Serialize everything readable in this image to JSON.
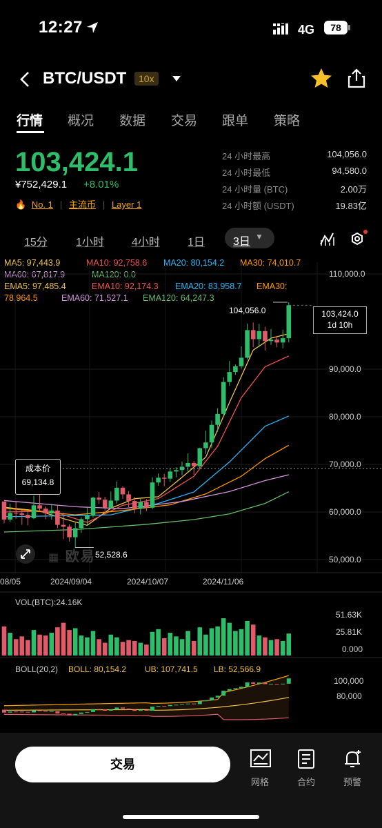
{
  "status": {
    "time": "12:27",
    "network": "4G",
    "battery": "78"
  },
  "header": {
    "pair": "BTC/USDT",
    "leverage": "10x"
  },
  "tabs": [
    "行情",
    "概况",
    "数据",
    "交易",
    "跟单",
    "策略"
  ],
  "price": {
    "last": "103,424.1",
    "cny": "¥752,429.1",
    "change": "+8.01%"
  },
  "tags": [
    "No. 1",
    "主流币",
    "Layer 1"
  ],
  "stats": [
    {
      "label": "24 小时最高",
      "value": "104,056.0"
    },
    {
      "label": "24 小时最低",
      "value": "94,580.0"
    },
    {
      "label": "24 小时量 (BTC)",
      "value": "2.00万"
    },
    {
      "label": "24 小时额 (USDT)",
      "value": "19.83亿"
    }
  ],
  "intervals": [
    "15分",
    "1小时",
    "4小时",
    "1日"
  ],
  "interval_active": "3日",
  "ma_legend": {
    "ma5": "MA5: 97,443.9",
    "ma10": "MA10: 92,758.6",
    "ma20": "MA20: 80,154.2",
    "ma30": "MA30: 74,010.7",
    "ma60": "MA60: 67,817.9",
    "ma120": "MA120: 0.0",
    "ema5": "EMA5: 97,485.4",
    "ema10": "EMA10: 92,174.3",
    "ema20": "EMA20: 83,958.7",
    "ema30a": "EMA30:",
    "ema30b": "78,964.5",
    "ema60": "EMA60: 71,527.1",
    "ema120": "EMA120: 64,247.3"
  },
  "chart": {
    "high_label": "104,056.0",
    "low_label": "52,528.6",
    "current_price": "103,424.0",
    "countdown": "1d 10h",
    "cost_label": "成本价",
    "cost_value": "69,134.8",
    "watermark": "欧易",
    "dates": [
      "08/05",
      "2024/09/04",
      "2024/10/07",
      "2024/11/06"
    ],
    "vol_label": "VOL(BTC):24.16K",
    "vol_ticks": [
      "51.63K",
      "25.81K",
      "0.000"
    ],
    "boll_title": "BOLL(20,2)",
    "boll_mid": "BOLL: 80,154.2",
    "boll_ub": "UB: 107,741.5",
    "boll_lb": "LB: 52,566.9",
    "boll_ticks": [
      "100,000",
      "80,000"
    ]
  },
  "chart_data": {
    "type": "candlestick",
    "title": "BTC/USDT 3日",
    "y_ticks": [
      110000,
      90000,
      80000,
      70000,
      60000,
      50000
    ],
    "ylim": [
      49500,
      112000
    ],
    "candles": [
      [
        62200,
        62200,
        58400,
        57600
      ],
      [
        58400,
        61700,
        59800,
        57900
      ],
      [
        59800,
        62300,
        59700,
        58600
      ],
      [
        59700,
        60400,
        59400,
        57300
      ],
      [
        59400,
        60200,
        58700,
        57200
      ],
      [
        58700,
        63400,
        61400,
        58500
      ],
      [
        61400,
        65000,
        60700,
        60200
      ],
      [
        60700,
        61200,
        59700,
        58500
      ],
      [
        59700,
        61700,
        60300,
        58400
      ],
      [
        60300,
        61400,
        57300,
        56600
      ],
      [
        57300,
        59800,
        56900,
        54300
      ],
      [
        56900,
        57400,
        54700,
        53800
      ],
      [
        54700,
        57800,
        56600,
        52500
      ],
      [
        56600,
        58900,
        58500,
        55600
      ],
      [
        58500,
        61000,
        59200,
        57200
      ],
      [
        59200,
        63200,
        63000,
        58800
      ],
      [
        63000,
        64200,
        62600,
        61700
      ],
      [
        62600,
        63200,
        60900,
        60300
      ],
      [
        60900,
        64300,
        62400,
        60600
      ],
      [
        62400,
        66400,
        65100,
        61800
      ],
      [
        65100,
        65400,
        63700,
        62800
      ],
      [
        63700,
        64400,
        62300,
        61000
      ],
      [
        62300,
        63200,
        60700,
        59700
      ],
      [
        60700,
        62800,
        62100,
        59500
      ],
      [
        62100,
        62700,
        60900,
        60200
      ],
      [
        60900,
        67300,
        66200,
        60600
      ],
      [
        66200,
        68100,
        67200,
        65500
      ],
      [
        67200,
        68000,
        67000,
        65400
      ],
      [
        67000,
        69300,
        68500,
        66300
      ],
      [
        68500,
        69400,
        68800,
        67300
      ],
      [
        68800,
        70600,
        69500,
        67700
      ],
      [
        69500,
        72300,
        70300,
        68500
      ],
      [
        70300,
        70700,
        69600,
        67800
      ],
      [
        69600,
        73500,
        73400,
        69000
      ],
      [
        73400,
        77100,
        74600,
        72200
      ],
      [
        74600,
        79200,
        78300,
        73400
      ],
      [
        78300,
        81800,
        80600,
        76800
      ],
      [
        80600,
        88300,
        87300,
        80100
      ],
      [
        87300,
        91700,
        89400,
        86500
      ],
      [
        89400,
        91000,
        90600,
        88800
      ],
      [
        90600,
        94800,
        92400,
        90100
      ],
      [
        92400,
        99600,
        98200,
        92000
      ],
      [
        98200,
        99800,
        96300,
        94600
      ],
      [
        96300,
        99500,
        98000,
        94600
      ],
      [
        98000,
        98900,
        95900,
        93900
      ],
      [
        95900,
        98400,
        96200,
        95100
      ],
      [
        96200,
        97000,
        95600,
        94600
      ],
      [
        95600,
        98300,
        96500,
        94400
      ],
      [
        96500,
        104056,
        103424,
        95600
      ]
    ],
    "volume": [
      32000,
      25000,
      18000,
      21000,
      17000,
      28000,
      23000,
      22000,
      25000,
      31000,
      36000,
      28000,
      30000,
      22000,
      20000,
      27000,
      18000,
      14000,
      23000,
      20000,
      15000,
      17000,
      16000,
      14000,
      12000,
      26000,
      29000,
      19000,
      25000,
      21000,
      18000,
      27000,
      16000,
      31000,
      23000,
      30000,
      32000,
      41000,
      36000,
      27000,
      29000,
      38000,
      34000,
      22000,
      20000,
      17000,
      18000,
      16000,
      24160
    ],
    "lines": [
      {
        "name": "MA5",
        "color": "#f0c24a",
        "values": [
          [
            0,
            61000
          ],
          [
            6,
            60200
          ],
          [
            10,
            58600
          ],
          [
            14,
            57200
          ],
          [
            18,
            60800
          ],
          [
            22,
            62800
          ],
          [
            26,
            63200
          ],
          [
            30,
            67300
          ],
          [
            34,
            71500
          ],
          [
            38,
            83000
          ],
          [
            42,
            94000
          ],
          [
            45,
            96500
          ],
          [
            48,
            97443.9
          ]
        ]
      },
      {
        "name": "MA10",
        "color": "#ef5350",
        "values": [
          [
            0,
            60000
          ],
          [
            8,
            60200
          ],
          [
            14,
            57800
          ],
          [
            20,
            61400
          ],
          [
            26,
            62800
          ],
          [
            32,
            67500
          ],
          [
            36,
            73800
          ],
          [
            40,
            84000
          ],
          [
            44,
            90500
          ],
          [
            48,
            92758.6
          ]
        ]
      },
      {
        "name": "MA20",
        "color": "#29b6f6",
        "values": [
          [
            0,
            59000
          ],
          [
            10,
            59200
          ],
          [
            18,
            59400
          ],
          [
            26,
            61800
          ],
          [
            32,
            64200
          ],
          [
            38,
            70500
          ],
          [
            44,
            78000
          ],
          [
            48,
            80154.2
          ]
        ]
      },
      {
        "name": "MA30",
        "color": "#ff9800",
        "values": [
          [
            0,
            60800
          ],
          [
            12,
            59400
          ],
          [
            20,
            60300
          ],
          [
            28,
            61500
          ],
          [
            34,
            63800
          ],
          [
            40,
            67500
          ],
          [
            44,
            71200
          ],
          [
            48,
            74010.7
          ]
        ]
      },
      {
        "name": "MA60",
        "color": "#ce93d8",
        "values": [
          [
            0,
            62400
          ],
          [
            12,
            61100
          ],
          [
            20,
            60700
          ],
          [
            30,
            62200
          ],
          [
            38,
            64300
          ],
          [
            44,
            66600
          ],
          [
            48,
            67817.9
          ]
        ]
      },
      {
        "name": "EMA120",
        "color": "#66bb6a",
        "values": [
          [
            0,
            55800
          ],
          [
            12,
            56300
          ],
          [
            24,
            57400
          ],
          [
            32,
            58400
          ],
          [
            38,
            59600
          ],
          [
            44,
            61800
          ],
          [
            48,
            64247.3
          ]
        ]
      }
    ]
  },
  "bottom": {
    "trade": "交易",
    "grid": "网格",
    "contract": "合约",
    "alert": "预警"
  }
}
